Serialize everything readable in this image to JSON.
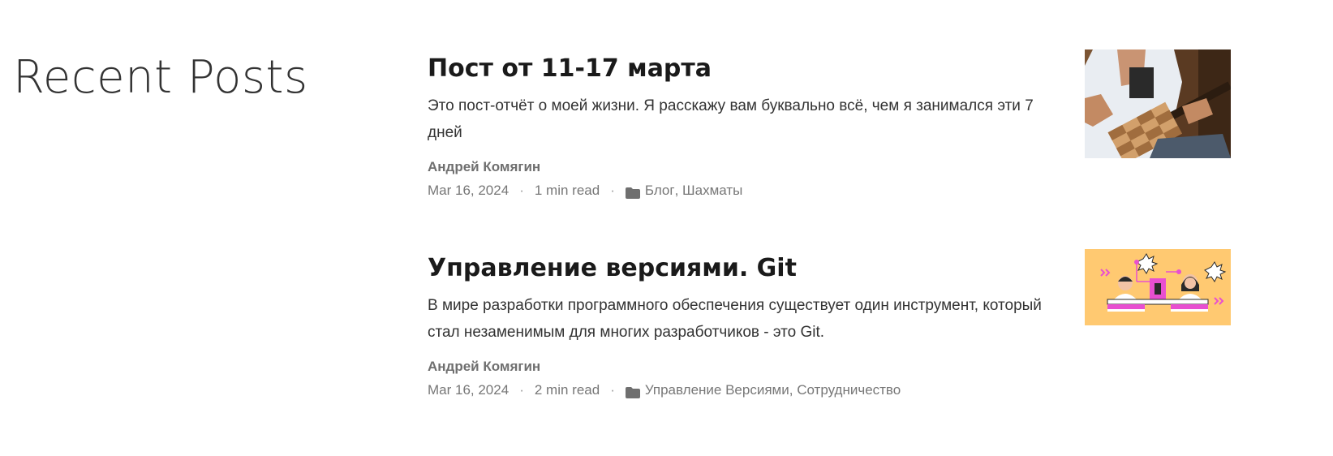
{
  "section": {
    "title": "Recent Posts"
  },
  "posts": [
    {
      "title": "Пост от 11-17 марта",
      "excerpt": "Это пост-отчёт о моей жизни. Я расскажу вам буквально всё, чем я занимался эти 7 дней",
      "author": "Андрей Комягин",
      "date": "Mar 16, 2024",
      "read_time": "1 min read",
      "categories": [
        "Блог",
        "Шахматы"
      ],
      "category_separator": ", ",
      "meta_dot": "·",
      "thumbnail_icon": "guitar-photo"
    },
    {
      "title": "Управление версиями. Git",
      "excerpt": "В мире разработки программного обеспечения существует один инструмент, который стал незаменимым для многих разработчиков - это Git.",
      "author": "Андрей Комягин",
      "date": "Mar 16, 2024",
      "read_time": "2 min read",
      "categories": [
        "Управление Версиями",
        "Сотрудничество"
      ],
      "category_separator": ", ",
      "meta_dot": "·",
      "thumbnail_icon": "developers-illustration"
    }
  ],
  "colors": {
    "title": "#1a1a1a",
    "meta": "#777777",
    "folder_icon": "#6f6f6f",
    "thumb2_background": "#ffc971",
    "thumb2_accent": "#e84fd0"
  }
}
